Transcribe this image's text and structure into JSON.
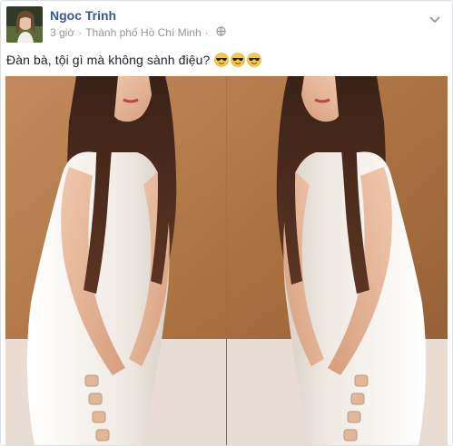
{
  "post": {
    "author_name": "Ngoc Trinh",
    "timestamp": "3 giờ",
    "separator": "·",
    "location": "Thành phố Hồ Chí Minh",
    "privacy_icon": "globe-icon",
    "menu_icon": "chevron-down-icon",
    "text": "Đàn bà, tội gì mà không sành điệu?",
    "emojis": [
      "sunglasses-emoji",
      "sunglasses-emoji",
      "sunglasses-emoji"
    ],
    "photo": {
      "left_panel": "portrait-mirror-left",
      "right_panel": "portrait-mirror-right"
    }
  },
  "colors": {
    "author_link": "#365899",
    "meta_text": "#90949c",
    "body_text": "#1d2129",
    "photo_background": "#b27a4f",
    "dress": "#f4f1ec",
    "hair": "#4a2a1a",
    "skin": "#e8b99a"
  }
}
